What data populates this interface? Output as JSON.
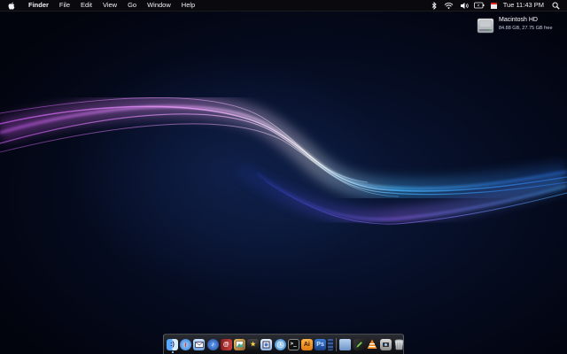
{
  "menubar": {
    "app_name": "Finder",
    "menus": [
      "File",
      "Edit",
      "View",
      "Go",
      "Window",
      "Help"
    ],
    "clock": "Tue 11:43 PM",
    "status_icons": [
      "bluetooth-icon",
      "wifi-icon",
      "volume-icon",
      "battery-icon",
      "calendar-icon",
      "spotlight-icon"
    ]
  },
  "desktop": {
    "disk_name": "Macintosh HD",
    "disk_info": "84.88 GB, 27.75 GB free"
  },
  "dock": {
    "items": [
      "finder-icon",
      "safari-icon",
      "mail-icon",
      "itunes-icon",
      "address-book-icon",
      "iphoto-icon",
      "imovie-icon",
      "preview-icon",
      "world-clock-icon",
      "terminal-icon",
      "illustrator-icon",
      "photoshop-icon",
      "dashboard-icon",
      "folder-icon",
      "pencil-icon",
      "vlc-icon",
      "screen-capture-icon",
      "trash-icon"
    ],
    "running": "finder-icon"
  },
  "colors": {
    "wave_pink": "#d65cff",
    "wave_blue": "#2e9bff",
    "background": "#040a1c"
  }
}
